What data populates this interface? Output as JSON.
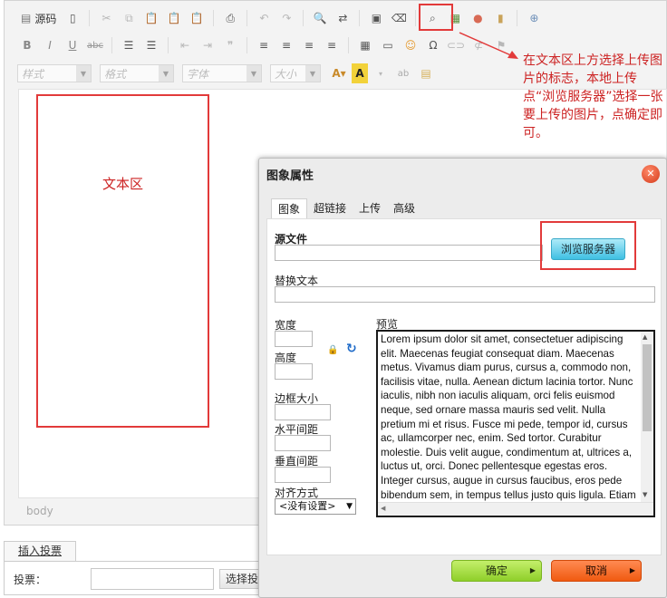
{
  "toolbar": {
    "source_label": "源码",
    "combos": [
      {
        "label": "样式"
      },
      {
        "label": "格式"
      },
      {
        "label": "字体"
      },
      {
        "label": "大小"
      }
    ]
  },
  "editor": {
    "text_region_label": "文本区",
    "status_path": "body"
  },
  "annotation": {
    "text": "在文本区上方选择上传图片的标志，本地上传点“浏览服务器”选择一张要上传的图片，点确定即可。"
  },
  "dialog": {
    "title": "图象属性",
    "tabs": [
      {
        "label": "图象",
        "active": true
      },
      {
        "label": "超链接",
        "active": false
      },
      {
        "label": "上传",
        "active": false
      },
      {
        "label": "高级",
        "active": false
      }
    ],
    "source_label": "源文件",
    "source_value": "",
    "browse_label": "浏览服务器",
    "alt_label": "替换文本",
    "width_label": "宽度",
    "height_label": "高度",
    "border_label": "边框大小",
    "hspace_label": "水平间距",
    "vspace_label": "垂直间距",
    "align_label": "对齐方式",
    "align_value": "<没有设置>",
    "preview_label": "预览",
    "preview_text": "Lorem ipsum dolor sit amet, consectetuer adipiscing elit. Maecenas feugiat consequat diam. Maecenas metus. Vivamus diam purus, cursus a, commodo non, facilisis vitae, nulla. Aenean dictum lacinia tortor. Nunc iaculis, nibh non iaculis aliquam, orci felis euismod neque, sed ornare massa mauris sed velit. Nulla pretium mi et risus. Fusce mi pede, tempor id, cursus ac, ullamcorper nec, enim. Sed tortor. Curabitur molestie. Duis velit augue, condimentum at, ultrices a, luctus ut, orci. Donec pellentesque egestas eros. Integer cursus, augue in cursus faucibus, eros pede bibendum sem, in tempus tellus justo quis ligula. Etiam eget tortor. Vestibulum rutrum, est ut placerat elementum",
    "ok_label": "确定",
    "cancel_label": "取消"
  },
  "vote": {
    "tab_label": "插入投票",
    "field_label": "投票：",
    "button_label": "选择投票"
  },
  "colors": {
    "highlight": "#e23a3a",
    "annotation_text": "#cc2222",
    "ok_green": "#8fcf2a",
    "cancel_orange": "#f05a10",
    "browse_blue": "#3fc0e3"
  }
}
